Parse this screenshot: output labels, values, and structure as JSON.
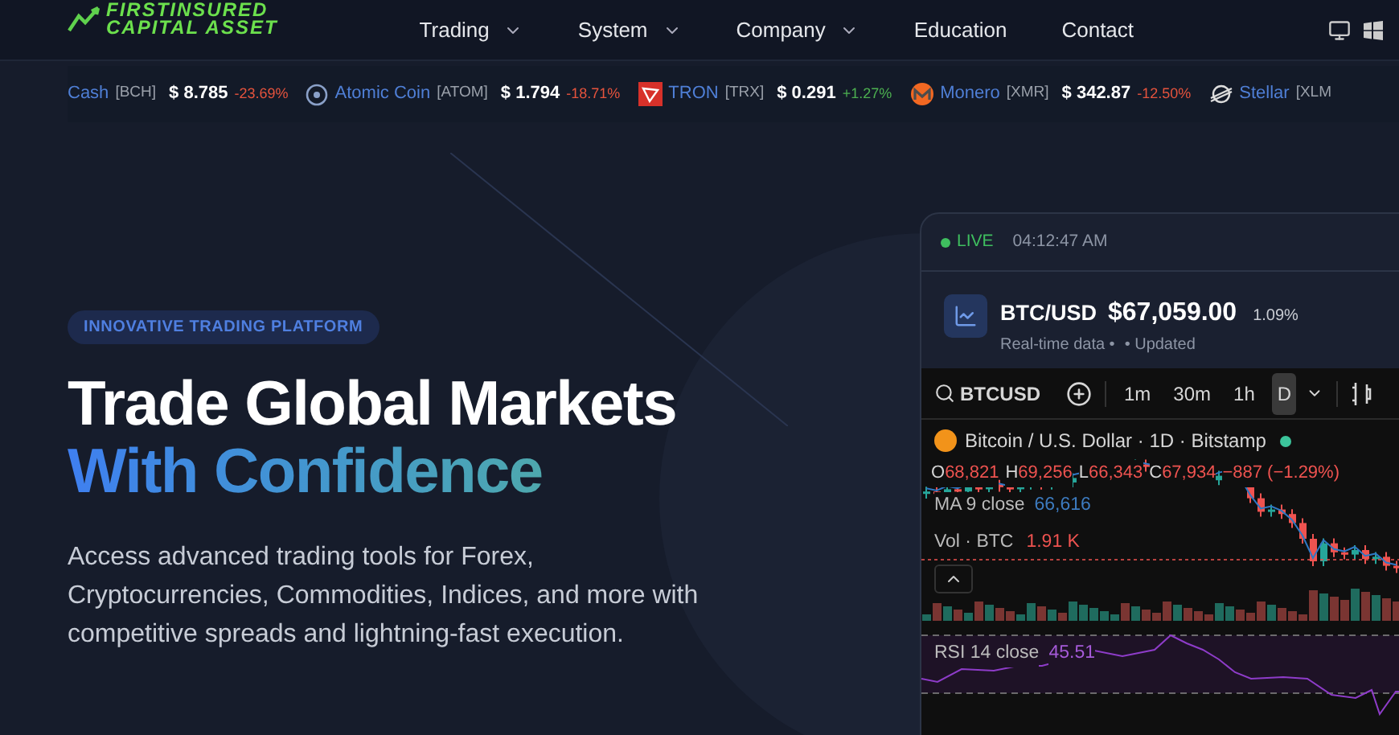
{
  "logo": {
    "line1": "FIRSTINSURED",
    "line2": "CAPITAL ASSET"
  },
  "nav": [
    {
      "label": "Trading",
      "dropdown": true
    },
    {
      "label": "System",
      "dropdown": true
    },
    {
      "label": "Company",
      "dropdown": true
    },
    {
      "label": "Education",
      "dropdown": false
    },
    {
      "label": "Contact",
      "dropdown": false
    }
  ],
  "ticker": [
    {
      "kind": "plain",
      "name": "Cash",
      "symbol": "[BCH]",
      "price": "$ 8.785",
      "change": "-23.69%",
      "color": "#e5533d"
    },
    {
      "kind": "atom",
      "name": "Atomic Coin",
      "symbol": "[ATOM]",
      "price": "$ 1.794",
      "change": "-18.71%",
      "color": "#e5533d"
    },
    {
      "kind": "tron",
      "name": "TRON",
      "symbol": "[TRX]",
      "price": "$ 0.291",
      "change": "+1.27%",
      "color": "#4caf50"
    },
    {
      "kind": "monero",
      "name": "Monero",
      "symbol": "[XMR]",
      "price": "$ 342.87",
      "change": "-12.50%",
      "color": "#e5533d"
    },
    {
      "kind": "stellar",
      "name": "Stellar",
      "symbol": "[XLM"
    }
  ],
  "hero": {
    "badge": "INNOVATIVE TRADING PLATFORM",
    "title_line1": "Trade Global Markets",
    "title_line2": "With Confidence",
    "description": "Access advanced trading tools for Forex, Cryptocurrencies, Commodities, Indices, and more with competitive spreads and lightning-fast execution."
  },
  "widget": {
    "status": "LIVE",
    "time": "04:12:47 AM",
    "pair": "BTC/USD",
    "price": "$67,059.00",
    "change": "1.09%",
    "note1": "Real-time data •",
    "note2": "• Updated",
    "toolbar": {
      "symbol": "BTCUSD",
      "timeframes": [
        {
          "label": "1m",
          "selected": false
        },
        {
          "label": "30m",
          "selected": false
        },
        {
          "label": "1h",
          "selected": false
        },
        {
          "label": "D",
          "selected": true
        }
      ]
    },
    "legend": {
      "title": "Bitcoin / U.S. Dollar · 1D · Bitstamp",
      "ohlc": [
        {
          "key": "O",
          "value": "68,821"
        },
        {
          "key": "H",
          "value": "69,256"
        },
        {
          "key": "L",
          "value": "66,343"
        },
        {
          "key": "C",
          "value": "67,934"
        }
      ],
      "change": "−887 (−1.29%)",
      "ma_label": "MA 9 close",
      "ma_value": "66,616",
      "vol_label": "Vol · BTC",
      "vol_value": "1.91 K"
    },
    "rsi": {
      "label": "RSI 14 close",
      "value": "45.51"
    }
  }
}
